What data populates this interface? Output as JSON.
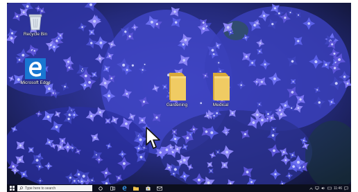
{
  "desktop": {
    "icons": [
      {
        "label": "Recycle Bin"
      },
      {
        "label": "Microsoft Edge"
      },
      {
        "label": "Gardening"
      },
      {
        "label": "Medical"
      }
    ]
  },
  "taskbar": {
    "search_placeholder": "Type here to search",
    "clock": "11:46"
  },
  "colors": {
    "folder": "#e8c15a",
    "edge_blue": "#1976d2",
    "taskbar": "#0c0f1d",
    "hydrangea": "#4a4fd6"
  }
}
